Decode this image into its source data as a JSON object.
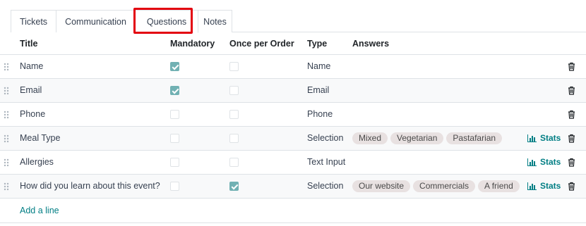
{
  "tabs": [
    {
      "label": "Tickets"
    },
    {
      "label": "Communication"
    },
    {
      "label": "Questions"
    },
    {
      "label": "Notes"
    }
  ],
  "active_tab": "Questions",
  "columns": {
    "title": "Title",
    "mandatory": "Mandatory",
    "once_per_order": "Once per Order",
    "type": "Type",
    "answers": "Answers"
  },
  "rows": [
    {
      "title": "Name",
      "mandatory": true,
      "once_per_order": false,
      "type": "Name",
      "answers": [],
      "stats": ""
    },
    {
      "title": "Email",
      "mandatory": true,
      "once_per_order": false,
      "type": "Email",
      "answers": [],
      "stats": ""
    },
    {
      "title": "Phone",
      "mandatory": false,
      "once_per_order": false,
      "type": "Phone",
      "answers": [],
      "stats": ""
    },
    {
      "title": "Meal Type",
      "mandatory": false,
      "once_per_order": false,
      "type": "Selection",
      "answers": [
        "Mixed",
        "Vegetarian",
        "Pastafarian"
      ],
      "stats": "Stats"
    },
    {
      "title": "Allergies",
      "mandatory": false,
      "once_per_order": false,
      "type": "Text Input",
      "answers": [],
      "stats": "Stats"
    },
    {
      "title": "How did you learn about this event?",
      "mandatory": false,
      "once_per_order": true,
      "type": "Selection",
      "answers": [
        "Our website",
        "Commercials",
        "A friend"
      ],
      "stats": "Stats"
    }
  ],
  "add_line_label": "Add a line",
  "colors": {
    "accent": "#017e84",
    "checkbox_checked": "#71b1b3",
    "highlight_box": "#e3000f",
    "tag_bg": "#e8e1e1"
  },
  "icons": {
    "drag": "drag-handle-icon",
    "delete": "trash-icon",
    "stats": "bar-chart-icon"
  }
}
